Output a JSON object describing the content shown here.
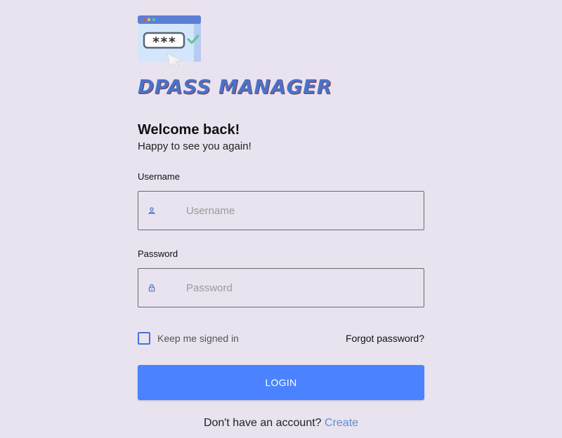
{
  "brand": {
    "name": "DPASS MANAGER",
    "logo_icon": "password-manager-logo",
    "password_mask": "***"
  },
  "header": {
    "title": "Welcome back!",
    "subtitle": "Happy to see you again!"
  },
  "form": {
    "username": {
      "label": "Username",
      "placeholder": "Username",
      "value": "",
      "icon": "user-icon"
    },
    "password": {
      "label": "Password",
      "placeholder": "Password",
      "value": "",
      "icon": "lock-icon"
    },
    "remember": {
      "label": "Keep me signed in",
      "checked": false
    },
    "forgot_label": "Forgot password?",
    "login_label": "LOGIN"
  },
  "footer": {
    "prompt": "Don't have an account?",
    "link_label": "Create"
  },
  "colors": {
    "background": "#e8e3ef",
    "brand": "#4a72c9",
    "primary_button": "#4a82ff",
    "link": "#5b8ed6",
    "checkbox_border": "#4a6fdc"
  }
}
